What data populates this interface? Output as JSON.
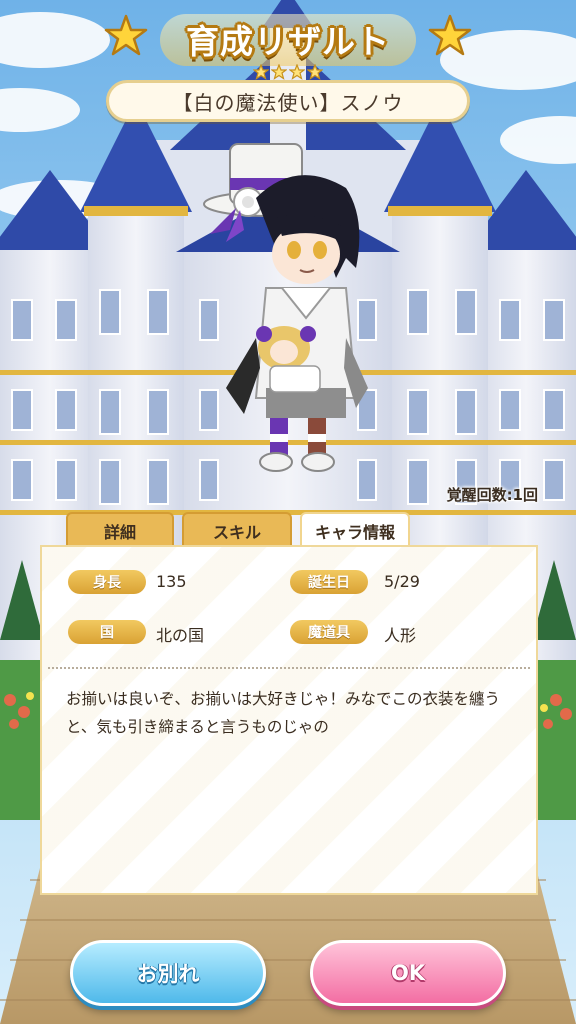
{
  "header": {
    "title": "育成リザルト",
    "rarity_stars": 4
  },
  "character": {
    "name": "【白の魔法使い】スノウ",
    "awakening": "覚醒回数:1回"
  },
  "tabs": [
    {
      "label": "詳細",
      "active": false
    },
    {
      "label": "スキル",
      "active": false
    },
    {
      "label": "キャラ情報",
      "active": true
    }
  ],
  "info": {
    "height_label": "身長",
    "height_value": "135",
    "birthday_label": "誕生日",
    "birthday_value": "5/29",
    "country_label": "国",
    "country_value": "北の国",
    "tool_label": "魔道具",
    "tool_value": "人形",
    "description": "お揃いは良いぞ、お揃いは大好きじゃ！みなでこの衣装を纏うと、気も引き締まると言うものじゃの"
  },
  "buttons": {
    "farewell": "お別れ",
    "ok": "OK"
  },
  "colors": {
    "sky": "#8cc6ee",
    "castle_wall": "#e9ecf4",
    "roof": "#2f4aa8",
    "gold": "#e2b640",
    "tab_gold": "#e9b956",
    "blue_button": "#4fb9ea",
    "pink_button": "#f36ea3"
  }
}
